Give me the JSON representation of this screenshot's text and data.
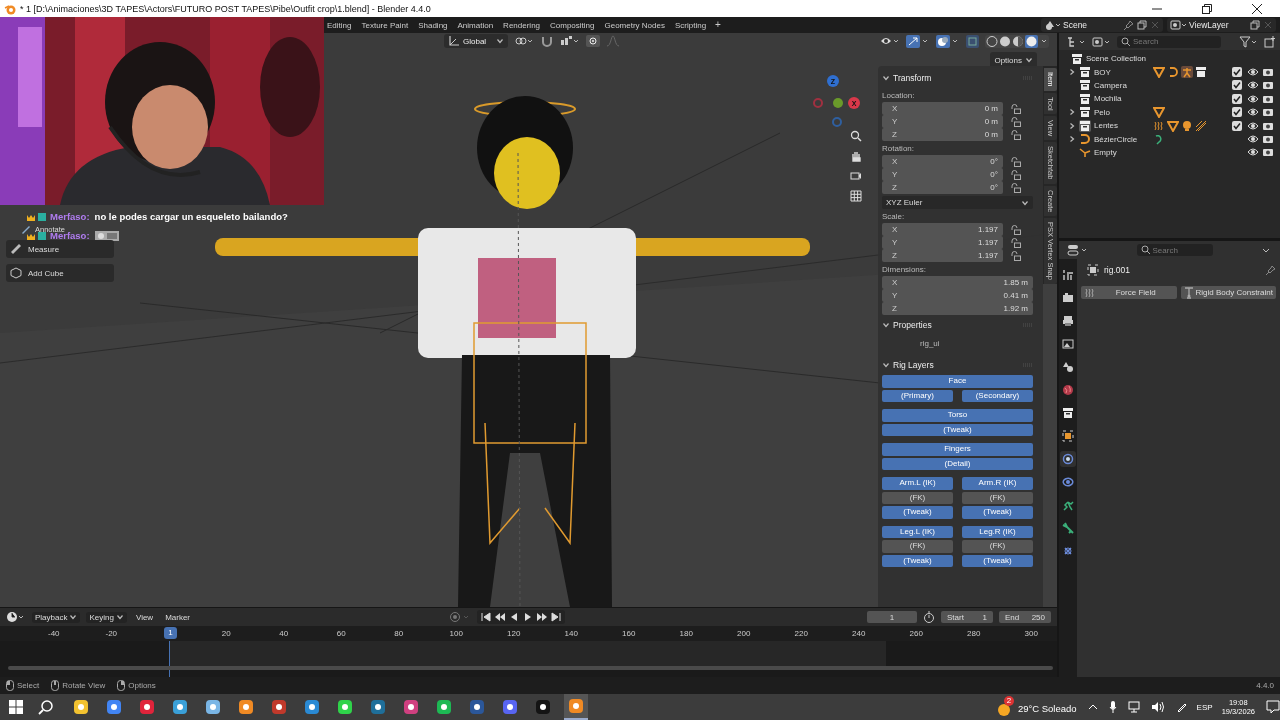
{
  "window": {
    "title": "* 1 [D:\\Animaciones\\3D TAPES\\Actors\\FUTURO POST TAPES\\Pibe\\Outfit crop\\1.blend] - Blender 4.4.0"
  },
  "workspaces": [
    {
      "label": "Editing",
      "selected": false
    },
    {
      "label": "Texture Paint",
      "selected": false
    },
    {
      "label": "Shading",
      "selected": false
    },
    {
      "label": "Animation",
      "selected": false
    },
    {
      "label": "Rendering",
      "selected": false
    },
    {
      "label": "Compositing",
      "selected": false
    },
    {
      "label": "Geometry Nodes",
      "selected": false
    },
    {
      "label": "Scripting",
      "selected": false
    }
  ],
  "add_workspace": "+",
  "scene": "Scene",
  "view_layer": "ViewLayer",
  "viewport": {
    "orientation": "Global",
    "options": "Options",
    "gizmo": [
      {
        "label": "Z",
        "color": "#2f6fd0"
      },
      {
        "label": "X",
        "color": "#d9384a"
      }
    ],
    "chat": [
      {
        "kind": "text",
        "user": "Merfaso:",
        "message": "no le podes cargar un esqueleto bailando?"
      },
      {
        "kind": "emote",
        "user": "Merfaso:"
      }
    ],
    "tools": [
      "Annotate",
      "Measure",
      "Add Cube"
    ]
  },
  "sidebar": {
    "tabs": [
      {
        "label": "Item",
        "selected": true
      },
      {
        "label": "Tool",
        "selected": false
      },
      {
        "label": "View",
        "selected": false
      },
      {
        "label": "Sketchfab",
        "selected": false
      },
      {
        "label": "Create",
        "selected": false
      },
      {
        "label": "PSX Vertex Snap",
        "selected": false
      }
    ],
    "transform": {
      "title": "Transform",
      "expanded": true,
      "sections": [
        {
          "label": "Location:",
          "fields": [
            {
              "axis": "X",
              "value": "0 m",
              "locked": false
            },
            {
              "axis": "Y",
              "value": "0 m",
              "locked": false
            },
            {
              "axis": "Z",
              "value": "0 m",
              "locked": false
            }
          ]
        },
        {
          "label": "Rotation:",
          "fields": [
            {
              "axis": "X",
              "value": "0°",
              "locked": false
            },
            {
              "axis": "Y",
              "value": "0°",
              "locked": false
            },
            {
              "axis": "Z",
              "value": "0°",
              "locked": false
            }
          ],
          "mode": "XYZ Euler"
        },
        {
          "label": "Scale:",
          "fields": [
            {
              "axis": "X",
              "value": "1.197",
              "locked": false
            },
            {
              "axis": "Y",
              "value": "1.197",
              "locked": false
            },
            {
              "axis": "Z",
              "value": "1.197",
              "locked": false
            }
          ]
        },
        {
          "label": "Dimensions:",
          "fields": [
            {
              "axis": "X",
              "value": "1.85 m"
            },
            {
              "axis": "Y",
              "value": "0.41 m"
            },
            {
              "axis": "Z",
              "value": "1.92 m"
            }
          ]
        }
      ]
    },
    "properties": {
      "title": "Properties",
      "expanded": true,
      "items": [
        "rig_ui"
      ]
    },
    "rig_layers": {
      "title": "Rig Layers",
      "expanded": true,
      "groups": [
        [
          [
            {
              "label": "Face",
              "on": true
            }
          ],
          [
            {
              "label": "(Primary)",
              "on": true
            },
            {
              "label": "(Secondary)",
              "on": true
            }
          ]
        ],
        [
          [
            {
              "label": "Torso",
              "on": true
            }
          ],
          [
            {
              "label": "(Tweak)",
              "on": true
            }
          ]
        ],
        [
          [
            {
              "label": "Fingers",
              "on": true
            }
          ],
          [
            {
              "label": "(Detail)",
              "on": true
            }
          ]
        ],
        [
          [
            {
              "label": "Arm.L (IK)",
              "on": true
            },
            {
              "label": "Arm.R (IK)",
              "on": true
            }
          ],
          [
            {
              "label": "(FK)",
              "on": false
            },
            {
              "label": "(FK)",
              "on": false
            }
          ],
          [
            {
              "label": "(Tweak)",
              "on": true
            },
            {
              "label": "(Tweak)",
              "on": true
            }
          ]
        ],
        [
          [
            {
              "label": "Leg.L (IK)",
              "on": true
            },
            {
              "label": "Leg.R (IK)",
              "on": true
            }
          ],
          [
            {
              "label": "(FK)",
              "on": false
            },
            {
              "label": "(FK)",
              "on": false
            }
          ],
          [
            {
              "label": "(Tweak)",
              "on": true
            },
            {
              "label": "(Tweak)",
              "on": true
            }
          ]
        ]
      ]
    }
  },
  "outliner": {
    "search_placeholder": "Search",
    "root": {
      "label": "Scene Collection",
      "kind": "collection",
      "selected": false,
      "children": [
        {
          "label": "BOY",
          "kind": "collection",
          "expanded": false,
          "selected": false,
          "checked": true,
          "visible": true,
          "extras": [
            {
              "kind": "mesh"
            },
            {
              "kind": "curve"
            },
            {
              "kind": "armature"
            },
            {
              "kind": "collection"
            }
          ]
        },
        {
          "label": "Campera",
          "kind": "collection",
          "selected": false,
          "checked": true,
          "visible": true
        },
        {
          "label": "Mochila",
          "kind": "collection",
          "selected": false,
          "checked": true,
          "visible": true
        },
        {
          "label": "Pelo",
          "kind": "collection",
          "expanded": false,
          "selected": false,
          "checked": true,
          "visible": true,
          "extras": [
            {
              "kind": "mesh"
            }
          ]
        },
        {
          "label": "Lentes",
          "kind": "collection",
          "expanded": false,
          "selected": true,
          "checked": true,
          "visible": true,
          "extras": [
            {
              "kind": "modifier"
            },
            {
              "kind": "mesh"
            },
            {
              "kind": "light"
            },
            {
              "kind": "hatch"
            }
          ]
        },
        {
          "label": "BézierCircle",
          "kind": "curve",
          "expanded": false,
          "selected": false,
          "visible": true,
          "extras": [
            {
              "kind": "constraint"
            }
          ]
        },
        {
          "label": "Empty",
          "kind": "empty",
          "selected": false,
          "visible": true
        }
      ]
    }
  },
  "properties_editor": {
    "search_placeholder": "Search",
    "tabs": [
      {
        "kind": "tool",
        "selected": false
      },
      {
        "kind": "render",
        "selected": false
      },
      {
        "kind": "output",
        "selected": false
      },
      {
        "kind": "view_layer",
        "selected": false
      },
      {
        "kind": "scene",
        "selected": false
      },
      {
        "kind": "world",
        "selected": false
      },
      {
        "kind": "collection",
        "selected": false
      },
      {
        "kind": "object",
        "selected": false
      },
      {
        "kind": "physics",
        "selected": true
      },
      {
        "kind": "object_constraint",
        "selected": false
      },
      {
        "kind": "object_data",
        "selected": false
      },
      {
        "kind": "bone",
        "selected": false
      },
      {
        "kind": "bone_constraint",
        "selected": false
      }
    ],
    "object_name": "rig.001",
    "buttons": [
      {
        "kind": "force",
        "label": "Force Field"
      },
      {
        "kind": "constraint",
        "label": "Rigid Body Constraint"
      }
    ]
  },
  "timeline": {
    "menus": [
      {
        "label": "Playback",
        "kind": "dropdown"
      },
      {
        "label": "Keying",
        "kind": "dropdown"
      },
      {
        "label": "View",
        "kind": "menu"
      },
      {
        "label": "Marker",
        "kind": "menu"
      }
    ],
    "current_frame": "1",
    "start_label": "Start",
    "start": "1",
    "end_label": "End",
    "end": "250",
    "ruler": [
      "-40",
      "-20",
      "20",
      "40",
      "60",
      "80",
      "100",
      "120",
      "140",
      "160",
      "180",
      "200",
      "220",
      "240",
      "260",
      "280",
      "300"
    ],
    "playhead": "1"
  },
  "status_bar": {
    "hints": [
      "Select",
      "Rotate View",
      "Options"
    ],
    "version": "4.4.0"
  },
  "taskbar": {
    "apps": [
      {
        "color": "#f2c230",
        "selected": false
      },
      {
        "color": "#4285f4",
        "selected": false
      },
      {
        "color": "#e0243b",
        "selected": false
      },
      {
        "color": "#3aa0d8",
        "selected": false
      },
      {
        "color": "#7ab6e6",
        "selected": false
      },
      {
        "color": "#f08a24",
        "selected": false
      },
      {
        "color": "#c0392b",
        "selected": false
      },
      {
        "color": "#2a8ad4",
        "selected": false
      },
      {
        "color": "#2fd34a",
        "selected": false
      },
      {
        "color": "#1f6f9a",
        "selected": false
      },
      {
        "color": "#d04080",
        "selected": false
      },
      {
        "color": "#1db954",
        "selected": false
      },
      {
        "color": "#2b579a",
        "selected": false
      },
      {
        "color": "#5865f2",
        "selected": false
      },
      {
        "color": "#141414",
        "selected": false
      },
      {
        "color": "#f08a24",
        "selected": true
      }
    ],
    "weather": {
      "badge": "2",
      "text": "29°C Soleado"
    },
    "language": "ESP",
    "time": "19:08",
    "date": "19/3/2026"
  }
}
